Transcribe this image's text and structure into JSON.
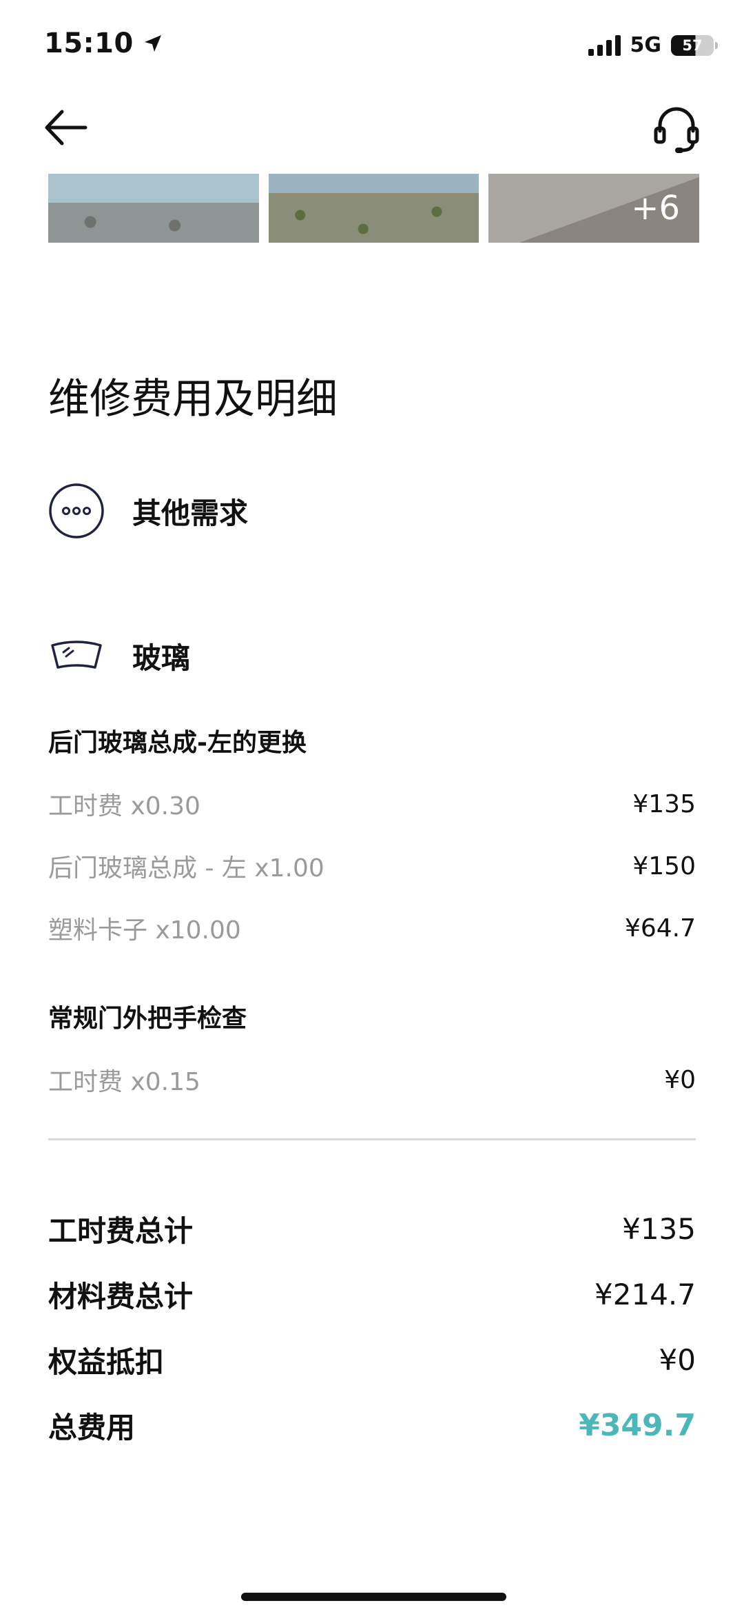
{
  "status": {
    "time": "15:10",
    "network": "5G",
    "battery": "57"
  },
  "nav": {
    "back_icon": "arrow-left-icon",
    "service_icon": "headset-icon"
  },
  "photos": {
    "more_count": "+6"
  },
  "section_title": "维修费用及明细",
  "categories": [
    {
      "icon": "more-dots-icon",
      "label": "其他需求"
    },
    {
      "icon": "windshield-icon",
      "label": "玻璃"
    }
  ],
  "groups": [
    {
      "title": "后门玻璃总成-左的更换",
      "lines": [
        {
          "name": "工时费 x0.30",
          "price": "¥135"
        },
        {
          "name": "后门玻璃总成 - 左 x1.00",
          "price": "¥150"
        },
        {
          "name": "塑料卡子 x10.00",
          "price": "¥64.7"
        }
      ]
    },
    {
      "title": "常规门外把手检查",
      "lines": [
        {
          "name": "工时费 x0.15",
          "price": "¥0"
        }
      ]
    }
  ],
  "totals": [
    {
      "name": "工时费总计",
      "value": "¥135"
    },
    {
      "name": "材料费总计",
      "value": "¥214.7"
    },
    {
      "name": "权益抵扣",
      "value": "¥0"
    },
    {
      "name": "总费用",
      "value": "¥349.7"
    }
  ],
  "colors": {
    "accent": "#4bb7b8"
  }
}
